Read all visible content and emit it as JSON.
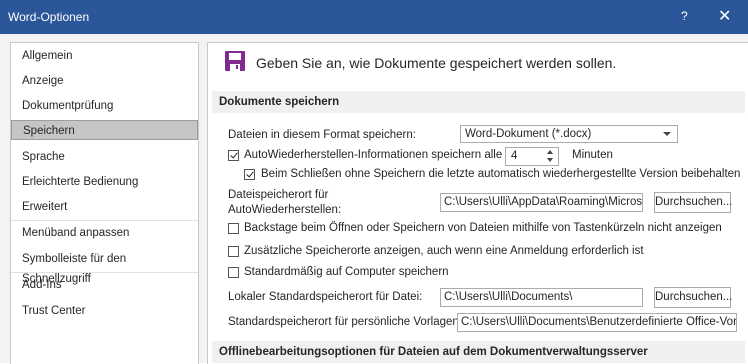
{
  "window": {
    "title": "Word-Optionen",
    "help": "?",
    "close": "✕"
  },
  "sidebar": {
    "items": [
      {
        "label": "Allgemein"
      },
      {
        "label": "Anzeige"
      },
      {
        "label": "Dokumentprüfung"
      },
      {
        "label": "Speichern",
        "selected": true
      },
      {
        "label": "Sprache"
      },
      {
        "label": "Erleichterte Bedienung"
      },
      {
        "label": "Erweitert"
      },
      {
        "label": "Menüband anpassen"
      },
      {
        "label": "Symbolleiste für den Schnellzugriff"
      },
      {
        "label": "Add-Ins"
      },
      {
        "label": "Trust Center"
      }
    ]
  },
  "header": {
    "text": "Geben Sie an, wie Dokumente gespeichert werden sollen.",
    "icon": "floppy-disk-icon",
    "accent": "#7f2b8f"
  },
  "sections": {
    "save_documents": "Dokumente speichern",
    "offline": "Offlinebearbeitungsoptionen für Dateien auf dem Dokumentverwaltungsserver"
  },
  "save": {
    "format_label": "Dateien in diesem Format speichern:",
    "format_value": "Word-Dokument (*.docx)",
    "autorecover_label": "AutoWiederherstellen-Informationen speichern alle",
    "autorecover_checked": true,
    "autorecover_minutes": "4",
    "minutes_label": "Minuten",
    "keep_last_label": "Beim Schließen ohne Speichern die letzte automatisch wiederhergestellte Version beibehalten",
    "keep_last_checked": true,
    "autorecover_location_label_1": "Dateispeicherort für",
    "autorecover_location_label_2": "AutoWiederherstellen:",
    "autorecover_path": "C:\\Users\\Ulli\\AppData\\Roaming\\Microsoft\\Word\\",
    "browse_label": "Durchsuchen...",
    "backstage_label": "Backstage beim Öffnen oder Speichern von Dateien mithilfe von Tastenkürzeln nicht anzeigen",
    "backstage_checked": false,
    "additional_locations_label": "Zusätzliche Speicherorte anzeigen, auch wenn eine Anmeldung erforderlich ist",
    "additional_locations_checked": false,
    "default_computer_label": "Standardmäßig auf Computer speichern",
    "default_computer_checked": false,
    "local_default_label": "Lokaler Standardspeicherort für Datei:",
    "local_default_path": "C:\\Users\\Ulli\\Documents\\",
    "templates_label": "Standardspeicherort für persönliche Vorlagen:",
    "templates_path": "C:\\Users\\Ulli\\Documents\\Benutzerdefinierte Office-Vorlagen\\"
  }
}
